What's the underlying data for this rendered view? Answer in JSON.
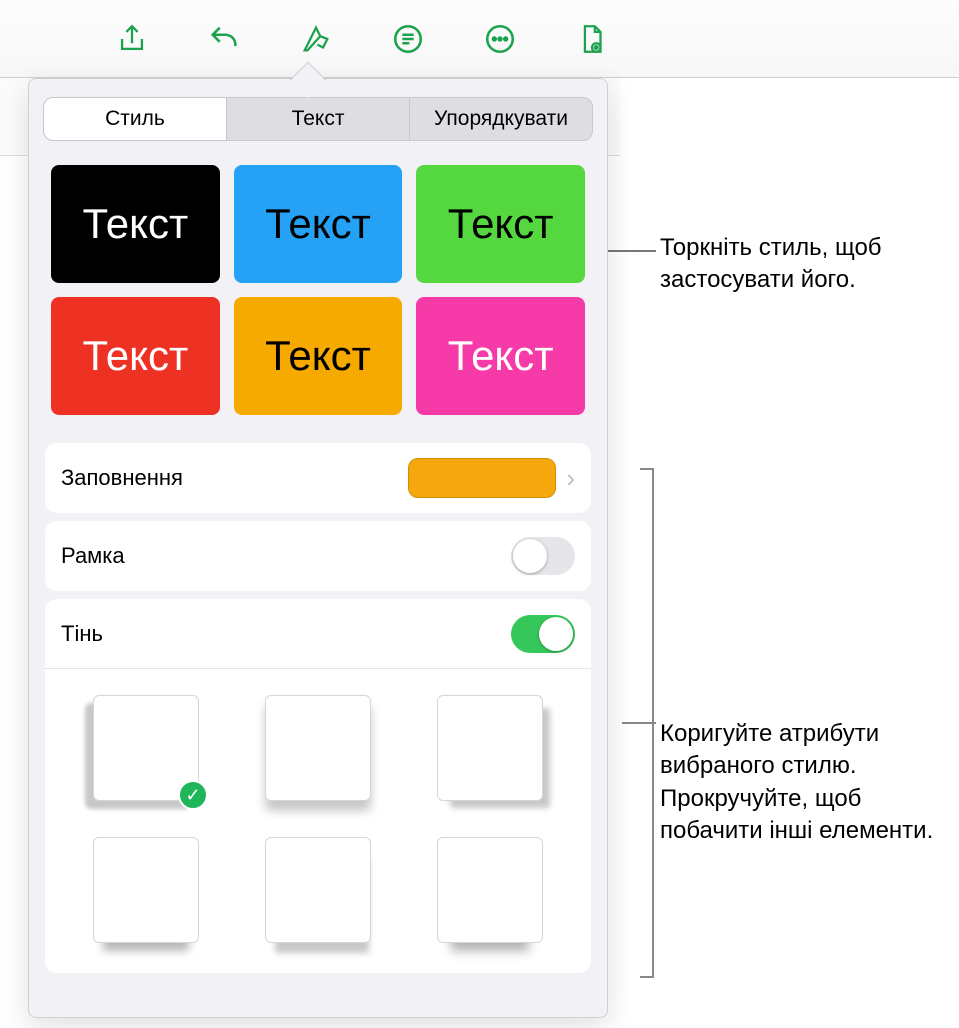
{
  "toolbar": {
    "icons": [
      "share-icon",
      "undo-icon",
      "format-icon",
      "list-icon",
      "more-icon",
      "document-icon"
    ]
  },
  "tabs": {
    "style": "Стиль",
    "text": "Текст",
    "arrange": "Упорядкувати"
  },
  "swatch_text": "Текст",
  "fill": {
    "label": "Заповнення",
    "color": "#f5a80d"
  },
  "border": {
    "label": "Рамка",
    "on": false
  },
  "shadow": {
    "label": "Тінь",
    "on": true,
    "selected": 0
  },
  "callouts": {
    "tap_style": "Торкніть стиль, щоб застосувати його.",
    "adjust": "Коригуйте атрибути вибраного стилю. Прокручуйте, щоб побачити інші елементи."
  }
}
